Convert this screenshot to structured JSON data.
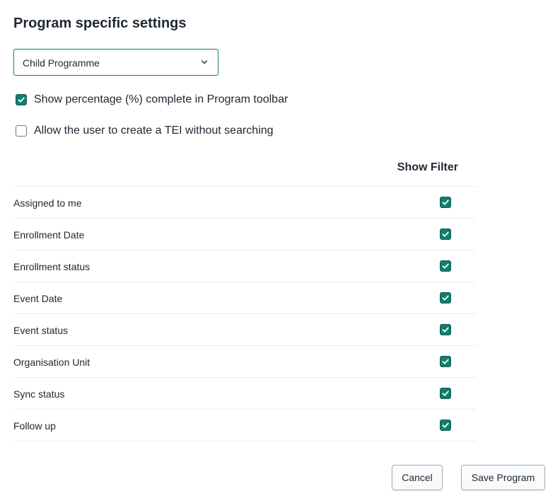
{
  "page": {
    "title": "Program specific settings"
  },
  "program_select": {
    "value": "Child Programme",
    "icon": "chevron-down-icon"
  },
  "options": [
    {
      "label": "Show percentage (%) complete in Program toolbar",
      "checked": true
    },
    {
      "label": "Allow the user to create a TEI without searching",
      "checked": false
    }
  ],
  "filters": {
    "column_header": "Show Filter",
    "rows": [
      {
        "label": "Assigned to me",
        "checked": true
      },
      {
        "label": "Enrollment Date",
        "checked": true
      },
      {
        "label": "Enrollment status",
        "checked": true
      },
      {
        "label": "Event Date",
        "checked": true
      },
      {
        "label": "Event status",
        "checked": true
      },
      {
        "label": "Organisation Unit",
        "checked": true
      },
      {
        "label": "Sync status",
        "checked": true
      },
      {
        "label": "Follow up",
        "checked": true
      }
    ]
  },
  "actions": {
    "cancel_label": "Cancel",
    "save_label": "Save Program"
  },
  "colors": {
    "accent": "#147d6f",
    "text": "#212934",
    "divider": "#e8edf2"
  }
}
